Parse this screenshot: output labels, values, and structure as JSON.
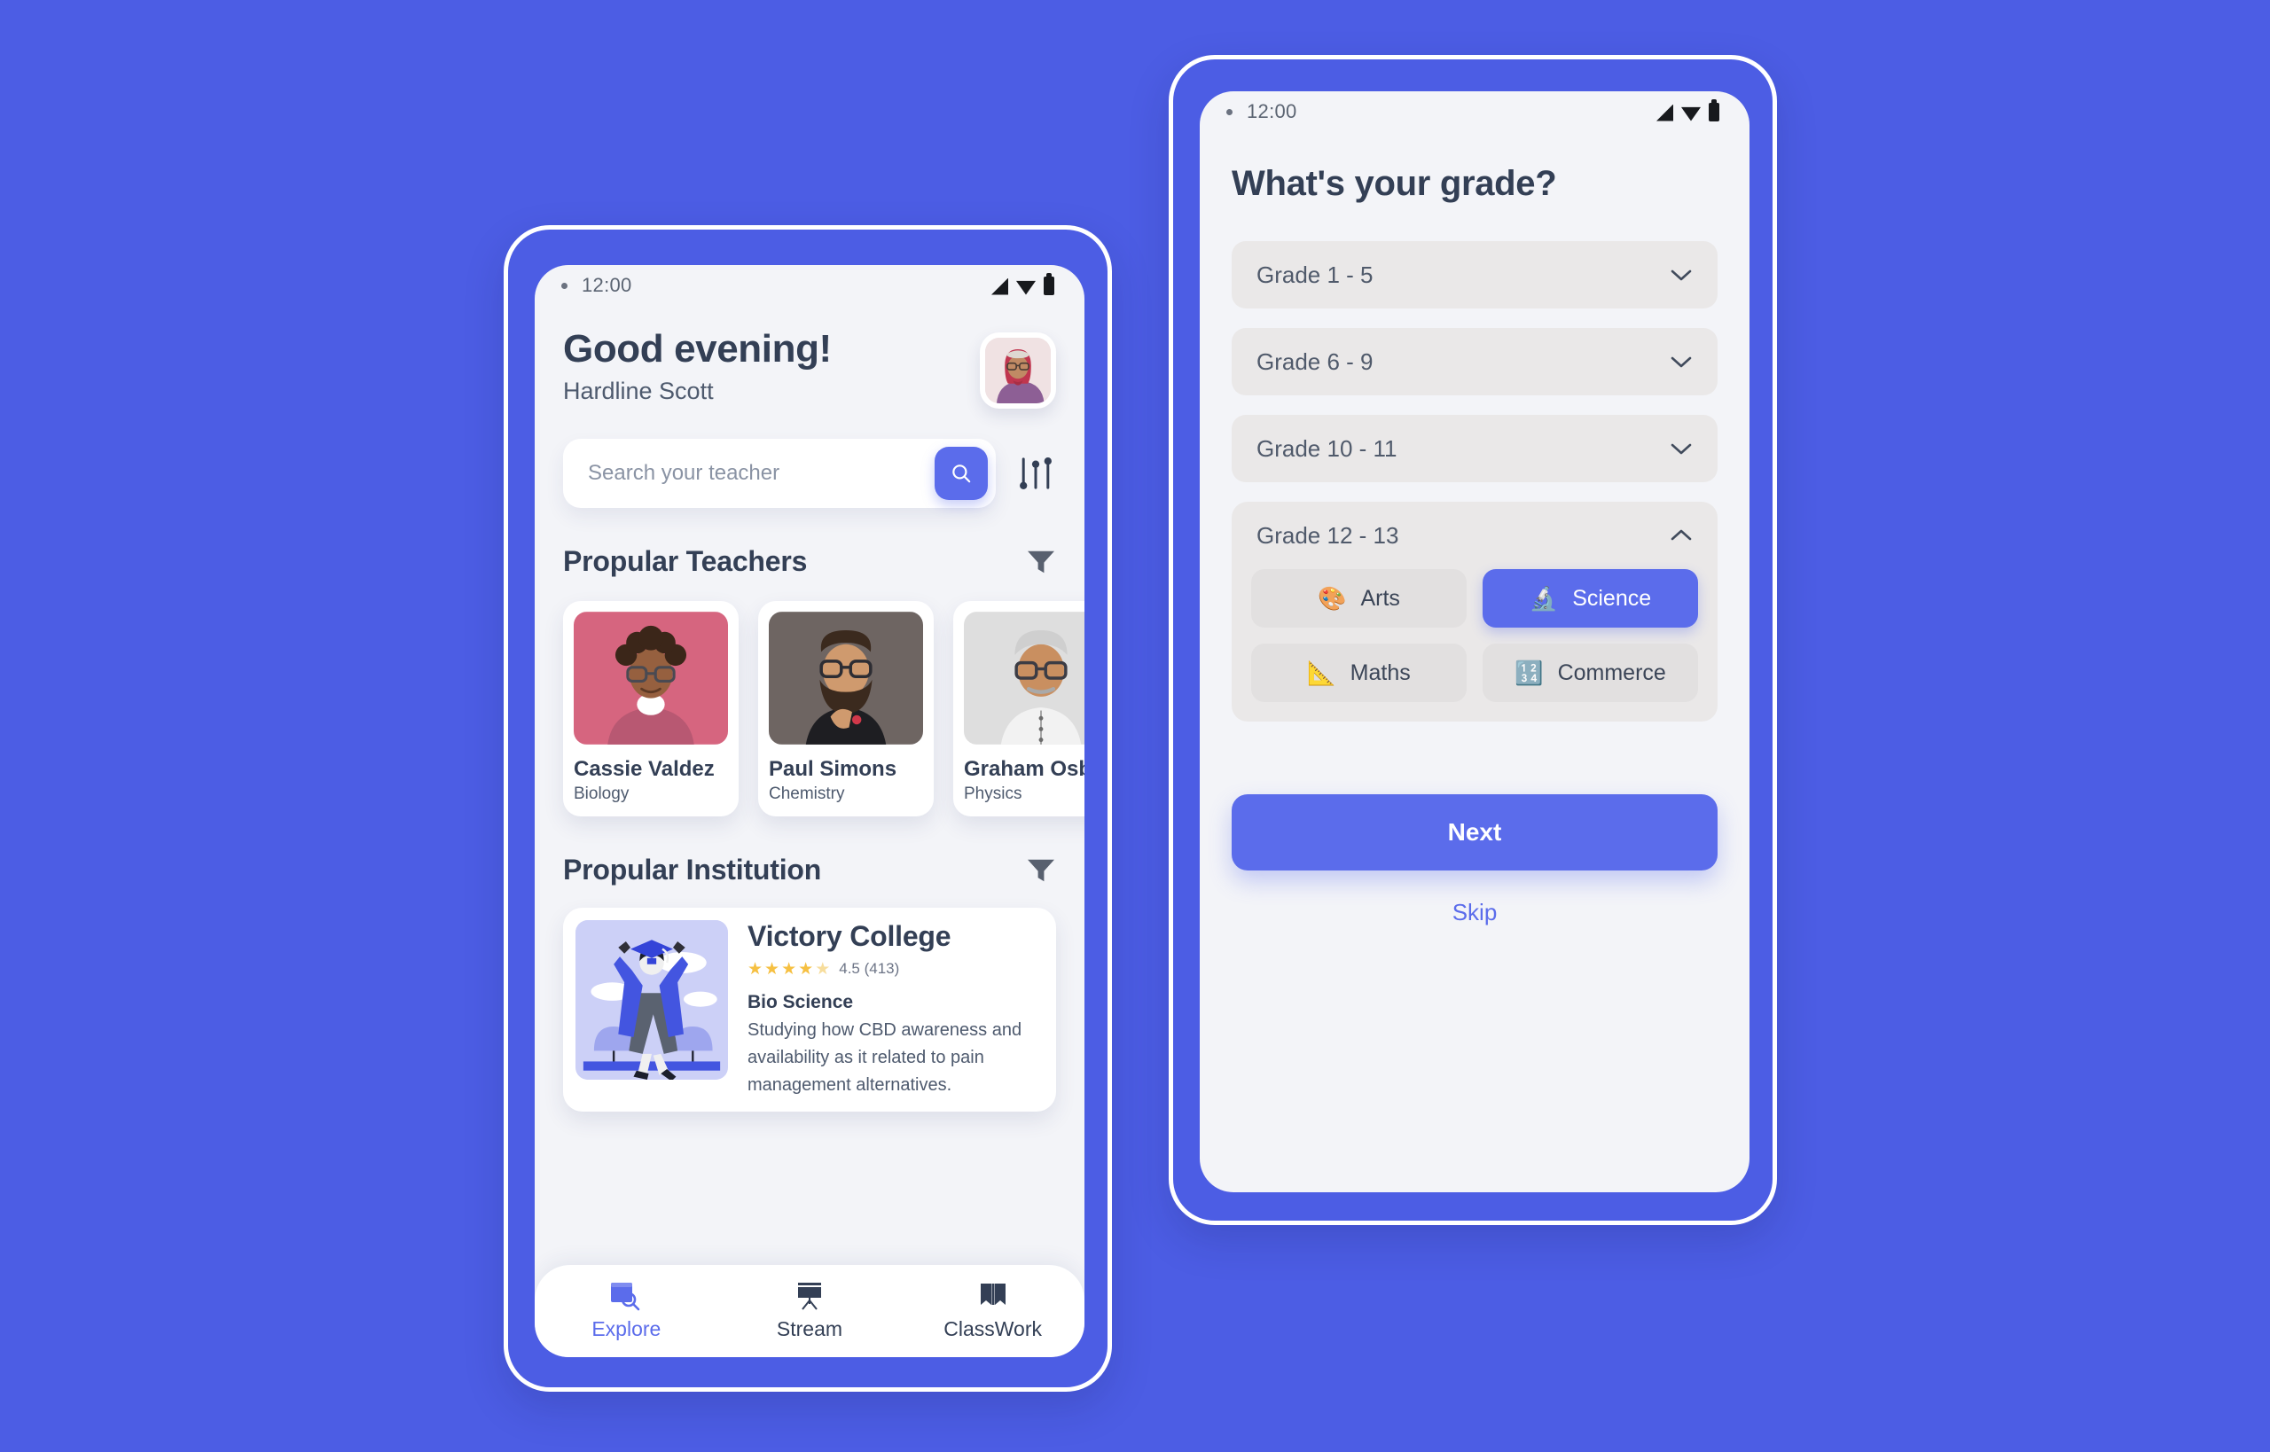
{
  "background_color": "#4c5de4",
  "accent_color": "#5b6ceb",
  "left_phone": {
    "status_bar": {
      "time": "12:00",
      "icons": [
        "signal-icon",
        "wifi-icon",
        "battery-icon"
      ]
    },
    "header": {
      "greeting": "Good evening!",
      "user_name": "Hardline Scott",
      "avatar": "user-avatar"
    },
    "search": {
      "placeholder": "Search your teacher",
      "value": "",
      "button_icon": "search-icon",
      "filter_icon": "sliders-icon"
    },
    "teachers_section": {
      "title": "Propular Teachers",
      "filter_icon": "funnel-icon",
      "cards": [
        {
          "name": "Cassie Valdez",
          "subject": "Biology",
          "photo_bg": "#d6657f"
        },
        {
          "name": "Paul Simons",
          "subject": "Chemistry",
          "photo_bg": "#6e6562"
        },
        {
          "name": "Graham Osborne",
          "subject": "Physics",
          "photo_bg": "#dedede"
        }
      ]
    },
    "institution_section": {
      "title": "Propular Institution",
      "filter_icon": "funnel-icon",
      "card": {
        "name": "Victory College",
        "rating_value": "4.5",
        "rating_count": "(413)",
        "rating_text": "4.5 (413)",
        "stars_full": 4,
        "stars_half": 1,
        "tag": "Bio Science",
        "description": "Studying how CBD awareness and availability as it related to pain management alternatives."
      }
    },
    "bottom_nav": {
      "items": [
        {
          "label": "Explore",
          "icon": "browser-search-icon",
          "active": true
        },
        {
          "label": "Stream",
          "icon": "presentation-board-icon",
          "active": false
        },
        {
          "label": "ClassWork",
          "icon": "open-book-icon",
          "active": false
        }
      ]
    }
  },
  "right_phone": {
    "status_bar": {
      "time": "12:00",
      "icons": [
        "signal-icon",
        "wifi-icon",
        "battery-icon"
      ]
    },
    "title": "What's your grade?",
    "grades": [
      {
        "label": "Grade  1 - 5",
        "expanded": false,
        "chevron": "chevron-down-icon"
      },
      {
        "label": "Grade  6 - 9",
        "expanded": false,
        "chevron": "chevron-down-icon"
      },
      {
        "label": "Grade  10 - 11",
        "expanded": false,
        "chevron": "chevron-down-icon"
      },
      {
        "label": "Grade  12 - 13",
        "expanded": true,
        "chevron": "chevron-up-icon"
      }
    ],
    "subjects": [
      {
        "label": "Arts",
        "emoji": "🎨",
        "selected": false
      },
      {
        "label": "Science",
        "emoji": "🔬",
        "selected": true
      },
      {
        "label": "Maths",
        "emoji": "📐",
        "selected": false
      },
      {
        "label": "Commerce",
        "emoji": "🔢",
        "selected": false
      }
    ],
    "next_label": "Next",
    "skip_label": "Skip"
  }
}
